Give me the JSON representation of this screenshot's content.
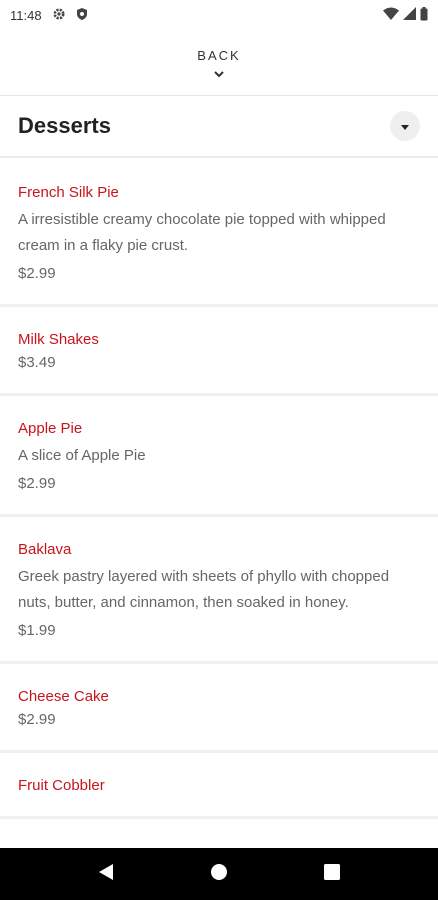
{
  "status_bar": {
    "time": "11:48"
  },
  "nav": {
    "back_label": "BACK"
  },
  "section": {
    "title": "Desserts"
  },
  "items": [
    {
      "name": "French Silk Pie",
      "description": "A irresistible creamy chocolate pie topped with whipped cream in a flaky pie crust.",
      "price": "$2.99"
    },
    {
      "name": "Milk Shakes",
      "description": "",
      "price": "$3.49"
    },
    {
      "name": "Apple Pie",
      "description": "A slice of Apple Pie",
      "price": "$2.99"
    },
    {
      "name": "Baklava",
      "description": "Greek pastry layered with sheets of phyllo with chopped nuts, butter, and cinnamon, then soaked in honey.",
      "price": "$1.99"
    },
    {
      "name": "Cheese Cake",
      "description": "",
      "price": "$2.99"
    },
    {
      "name": "Fruit Cobbler",
      "description": "",
      "price": ""
    }
  ],
  "colors": {
    "item_name": "#c8141c",
    "nav_bar": "#000000"
  },
  "icons": [
    "gear-icon",
    "shield-icon",
    "wifi-icon",
    "signal-icon",
    "battery-icon",
    "chevron-down-icon",
    "caret-down-icon",
    "back-triangle-icon",
    "home-circle-icon",
    "recents-square-icon"
  ]
}
